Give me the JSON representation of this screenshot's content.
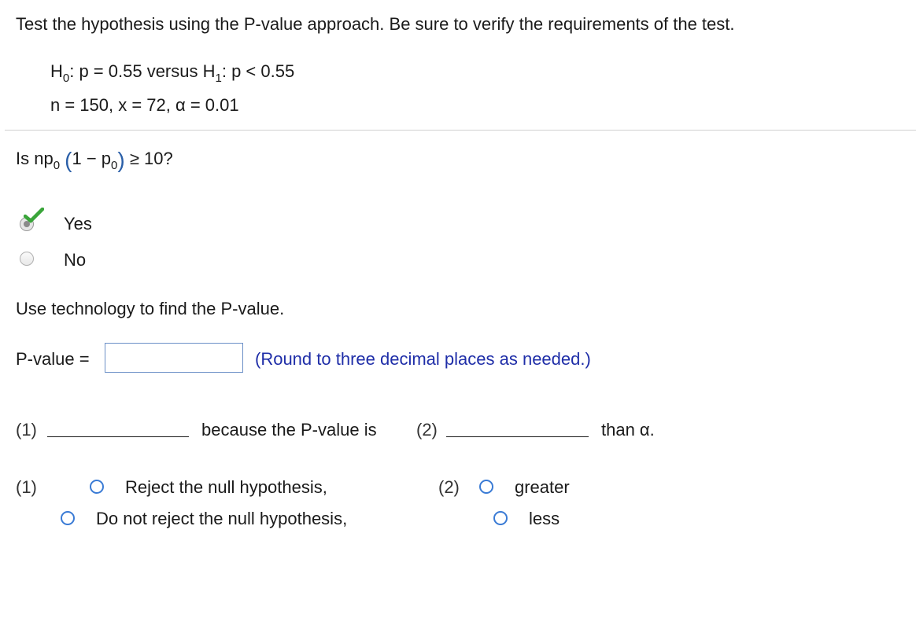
{
  "question": {
    "instruction": "Test the hypothesis using the P-value approach. Be sure to verify the requirements of the test.",
    "h0_label": "H",
    "h0_sub": "0",
    "h0_rest": ": p = 0.55 versus H",
    "h1_sub": "1",
    "h1_rest": ": p < 0.55",
    "params": "n = 150, x = 72, α = 0.01"
  },
  "requirement": {
    "prefix": "Is np",
    "sub0": "0",
    "open": "(",
    "mid": "1 − p",
    "sub1": "0",
    "close": ")",
    "suffix": "≥ 10?",
    "options": [
      {
        "label": "Yes",
        "selected": true,
        "correct": true
      },
      {
        "label": "No",
        "selected": false
      }
    ]
  },
  "pvalue": {
    "instruction": "Use technology to find the P-value.",
    "label": "P-value =",
    "value": "",
    "hint": "(Round to three decimal places as needed.)"
  },
  "conclusion": {
    "blank1": "(1)",
    "middle": "because the P-value is",
    "blank2": "(2)",
    "end": "than α.",
    "group1_label": "(1)",
    "group1_options": [
      "Reject the null hypothesis,",
      "Do not reject the null hypothesis,"
    ],
    "group2_label": "(2)",
    "group2_options": [
      "greater",
      "less"
    ]
  },
  "colors": {
    "accent": "#3a7bd5",
    "hint": "#1f2ea8",
    "check": "#3aa53a"
  }
}
